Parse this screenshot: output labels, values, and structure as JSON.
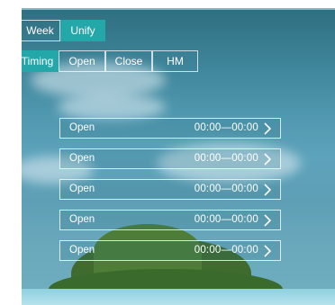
{
  "mode_tabs": [
    {
      "label": "Week",
      "active": false
    },
    {
      "label": "Unify",
      "active": true
    }
  ],
  "sub_tabs": [
    {
      "label": "Timing",
      "active": true
    },
    {
      "label": "Open",
      "active": false
    },
    {
      "label": "Close",
      "active": false
    },
    {
      "label": "HM",
      "active": false
    }
  ],
  "schedule_rows": [
    {
      "label": "Open",
      "time": "00:00—00:00",
      "icon": "chevron-right-icon"
    },
    {
      "label": "Open",
      "time": "00:00—00:00",
      "icon": "chevron-right-icon"
    },
    {
      "label": "Open",
      "time": "00:00—00:00",
      "icon": "chevron-right-icon"
    },
    {
      "label": "Open",
      "time": "00:00—00:00",
      "icon": "chevron-right-icon"
    },
    {
      "label": "Open",
      "time": "00:00—00:00",
      "icon": "chevron-right-icon"
    }
  ],
  "colors": {
    "accent": "#23a7a9",
    "text": "#ffffff"
  }
}
